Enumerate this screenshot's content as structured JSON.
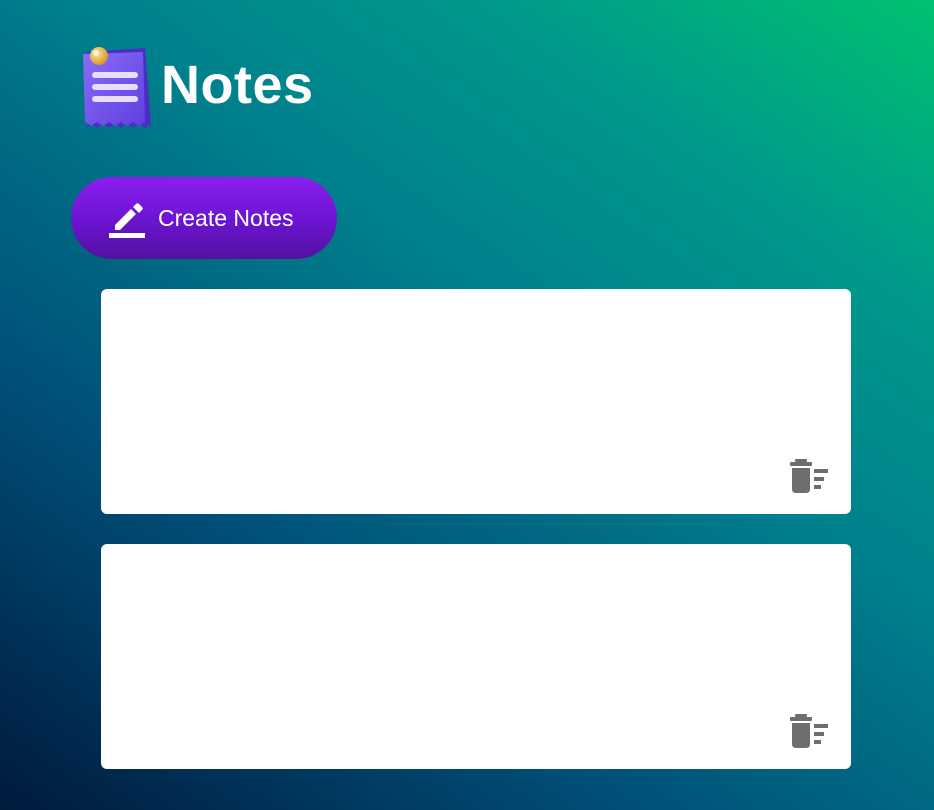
{
  "app": {
    "title": "Notes",
    "logo_icon": "notepad-pin-icon"
  },
  "toolbar": {
    "create_label": "Create Notes",
    "create_icon": "pencil-icon"
  },
  "notes": [
    {
      "text": "",
      "delete_icon": "delete-sweep-icon"
    },
    {
      "text": "",
      "delete_icon": "delete-sweep-icon"
    }
  ],
  "colors": {
    "background_top_right": "#00c170",
    "background_bottom_left": "#001a3d",
    "button_purple": "#7a18e0",
    "card_background": "#ffffff",
    "icon_gray": "#6e6e6e"
  }
}
